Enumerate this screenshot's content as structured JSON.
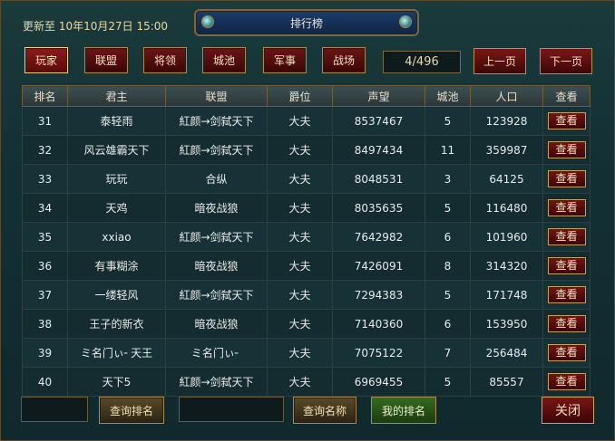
{
  "header": {
    "update_text": "更新至  10年10月27日  15:00",
    "title": "排行榜"
  },
  "categories": [
    "玩家",
    "联盟",
    "将领",
    "城池",
    "军事",
    "战场"
  ],
  "active_category": "玩家",
  "pager": {
    "indicator": "4/496",
    "prev_label": "上一页",
    "next_label": "下一页"
  },
  "table": {
    "headers": [
      "排名",
      "君主",
      "联盟",
      "爵位",
      "声望",
      "城池",
      "人口",
      "查看"
    ],
    "view_label": "查看",
    "rows": [
      {
        "rank": "31",
        "lord": "泰轻雨",
        "alliance": "紅颜→剑弑天下",
        "title": "大夫",
        "prestige": "8537467",
        "cities": "5",
        "population": "123928"
      },
      {
        "rank": "32",
        "lord": "风云雄霸天下",
        "alliance": "紅颜→剑弑天下",
        "title": "大夫",
        "prestige": "8497434",
        "cities": "11",
        "population": "359987"
      },
      {
        "rank": "33",
        "lord": "玩玩",
        "alliance": "合纵",
        "title": "大夫",
        "prestige": "8048531",
        "cities": "3",
        "population": "64125"
      },
      {
        "rank": "34",
        "lord": "天鸡",
        "alliance": "暗夜战狼",
        "title": "大夫",
        "prestige": "8035635",
        "cities": "5",
        "population": "116480"
      },
      {
        "rank": "35",
        "lord": "xxiao",
        "alliance": "紅颜→剑弑天下",
        "title": "大夫",
        "prestige": "7642982",
        "cities": "6",
        "population": "101960"
      },
      {
        "rank": "36",
        "lord": "有事糊涂",
        "alliance": "暗夜战狼",
        "title": "大夫",
        "prestige": "7426091",
        "cities": "8",
        "population": "314320"
      },
      {
        "rank": "37",
        "lord": "一缕轻风",
        "alliance": "紅颜→剑弑天下",
        "title": "大夫",
        "prestige": "7294383",
        "cities": "5",
        "population": "171748"
      },
      {
        "rank": "38",
        "lord": "王子的新衣",
        "alliance": "暗夜战狼",
        "title": "大夫",
        "prestige": "7140360",
        "cities": "6",
        "population": "153950"
      },
      {
        "rank": "39",
        "lord": "ミ名门ぃ╴天王",
        "alliance": "ミ名门ぃ╴",
        "title": "大夫",
        "prestige": "7075122",
        "cities": "7",
        "population": "256484"
      },
      {
        "rank": "40",
        "lord": "天下5",
        "alliance": "紅颜→剑弑天下",
        "title": "大夫",
        "prestige": "6969455",
        "cities": "5",
        "population": "85557"
      }
    ]
  },
  "footer": {
    "rank_input_value": "",
    "query_rank_label": "查询排名",
    "name_input_value": "",
    "query_name_label": "查询名称",
    "my_rank_label": "我的排名",
    "close_label": "关闭"
  }
}
